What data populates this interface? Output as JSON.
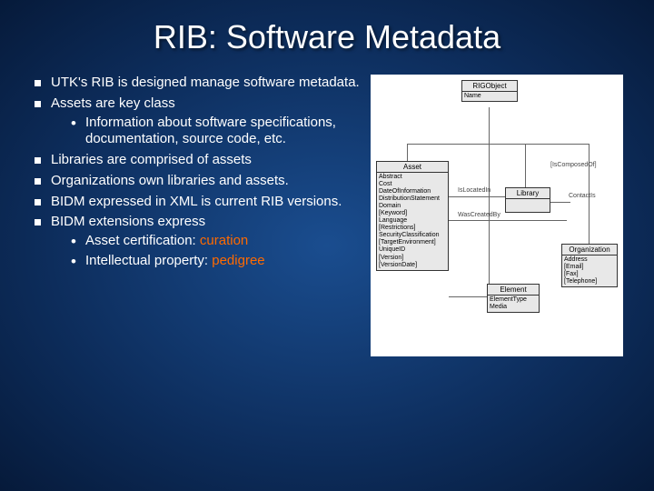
{
  "title": "RIB: Software Metadata",
  "bullets": {
    "b1": "UTK's RIB is designed manage software metadata.",
    "b2": "Assets are key class",
    "b2_1": "Information about software specifications, documentation, source code, etc.",
    "b3": "Libraries are comprised of assets",
    "b4": "Organizations own libraries and assets.",
    "b5": "BIDM expressed in XML is current RIB versions.",
    "b6": "BIDM extensions express",
    "b6_1_pre": "Asset certification: ",
    "b6_1_hl": "curation",
    "b6_2_pre": "Intellectual property: ",
    "b6_2_hl": "pedigree"
  },
  "diagram": {
    "rigobject": {
      "name": "RIGObject",
      "attr": "Name"
    },
    "asset": {
      "name": "Asset",
      "attrs": [
        "Abstract",
        "Cost",
        "DateOfInformation",
        "DistributionStatement",
        "Domain",
        "[Keyword]",
        "Language",
        "[Restrictions]",
        "SecurityClassification",
        "[TargetEnvironment]",
        "UniqueID",
        "[Version]",
        "[VersionDate]"
      ]
    },
    "library": {
      "name": "Library",
      "attrs": []
    },
    "element": {
      "name": "Element",
      "attrs": [
        "ElementType",
        "Media"
      ]
    },
    "organization": {
      "name": "Organization",
      "attrs": [
        "Address",
        "[Email]",
        "[Fax]",
        "[Telephone]"
      ]
    },
    "rel": {
      "iscomposedof": "[IsComposedOf]",
      "islocatedin": "IsLocatedIn",
      "wascreatedby": "WasCreatedBy",
      "contacts": "ContactIs"
    }
  }
}
